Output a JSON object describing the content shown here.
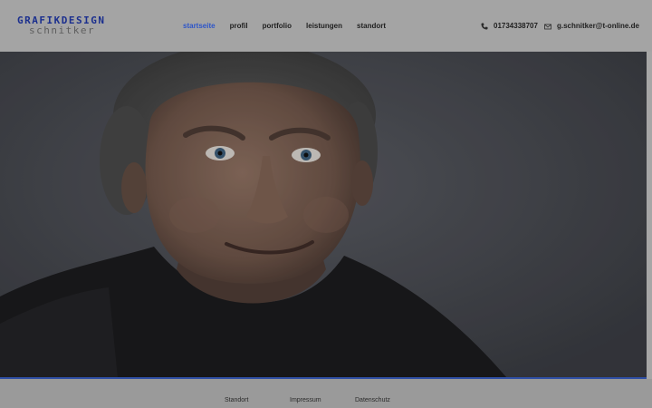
{
  "logo": {
    "line1": "GRAFIKDESIGN",
    "line2": "schnitker"
  },
  "nav": {
    "items": [
      {
        "label": "startseite",
        "active": true
      },
      {
        "label": "profil"
      },
      {
        "label": "portfolio"
      },
      {
        "label": "leistungen"
      },
      {
        "label": "standort"
      }
    ]
  },
  "contact": {
    "phone": "01734338707",
    "phone_icon": "phone-icon",
    "email": "g.schnitker@t-online.de",
    "email_icon": "mail-icon"
  },
  "hero": {
    "image": "portrait-photo"
  },
  "footer": {
    "links": [
      {
        "label": "Standort"
      },
      {
        "label": "Impressum"
      },
      {
        "label": "Datenschutz"
      }
    ]
  },
  "colors": {
    "accent": "#2d55c9",
    "brand": "#1b2f8e",
    "header_bg": "#a4a4a4",
    "footer_bg": "#9a9a9a"
  }
}
